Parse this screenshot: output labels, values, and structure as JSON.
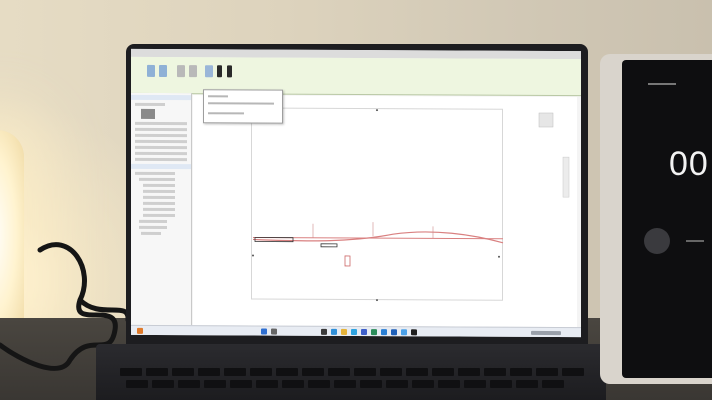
{
  "scene": {
    "description_label": "",
    "tablet_timer_digits": "00"
  },
  "colors": {
    "wall": "#ddd3bd",
    "desk": "#433f3a",
    "ribbon_green": "#eef6e0",
    "screen_bg": "#f4f4f4",
    "tablet_screen": "#0e0e10",
    "drawing_red": "#d98080"
  }
}
